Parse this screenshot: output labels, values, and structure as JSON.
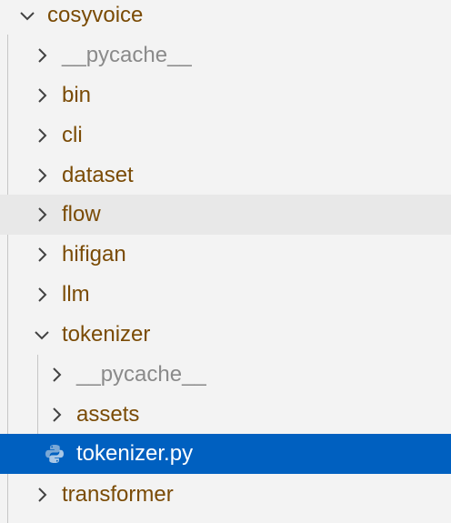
{
  "explorer": {
    "root": {
      "label": "cosyvoice",
      "icon": "chevron-down-icon"
    },
    "items": [
      {
        "label": "__pycache__",
        "icon": "chevron-right-icon"
      },
      {
        "label": "bin",
        "icon": "chevron-right-icon"
      },
      {
        "label": "cli",
        "icon": "chevron-right-icon"
      },
      {
        "label": "dataset",
        "icon": "chevron-right-icon"
      },
      {
        "label": "flow",
        "icon": "chevron-right-icon"
      },
      {
        "label": "hifigan",
        "icon": "chevron-right-icon"
      },
      {
        "label": "llm",
        "icon": "chevron-right-icon"
      },
      {
        "label": "tokenizer",
        "icon": "chevron-down-icon"
      },
      {
        "label": "__pycache__",
        "icon": "chevron-right-icon"
      },
      {
        "label": "assets",
        "icon": "chevron-right-icon"
      },
      {
        "label": "tokenizer.py",
        "icon": "python-file-icon"
      },
      {
        "label": "transformer",
        "icon": "chevron-right-icon"
      }
    ]
  },
  "colors": {
    "background": "#f3f3f3",
    "folder_text": "#7a4b05",
    "ignored_text": "#8a8a8a",
    "hover_background": "#e8e8e8",
    "selection_background": "#0060c0",
    "selection_text": "#ffffff"
  }
}
